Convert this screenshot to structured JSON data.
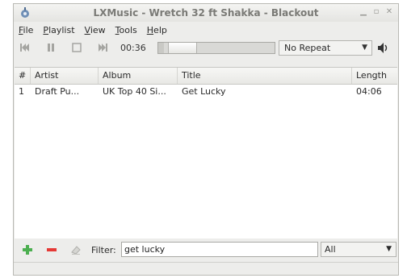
{
  "window": {
    "title": "LXMusic - Wretch 32 ft Shakka - Blackout",
    "controls": [
      "minimize-icon",
      "maximize-icon",
      "close-icon"
    ]
  },
  "menubar": {
    "items": [
      {
        "first": "F",
        "rest": "ile"
      },
      {
        "first": "P",
        "rest": "laylist"
      },
      {
        "first": "V",
        "rest": "iew"
      },
      {
        "first": "T",
        "rest": "ools"
      },
      {
        "first": "H",
        "rest": "elp"
      }
    ]
  },
  "toolbar": {
    "icons": [
      "previous-icon",
      "pause-icon",
      "stop-icon",
      "next-icon"
    ],
    "time": "00:36",
    "progress": 0.05,
    "repeat_value": "No Repeat",
    "volume_icon": "volume-icon"
  },
  "table": {
    "headers": [
      "#",
      "Artist",
      "Album",
      "Title",
      "Length"
    ],
    "rows": [
      [
        "1",
        "Draft Pu...",
        "UK Top 40 Si...",
        "Get Lucky",
        "04:06"
      ]
    ]
  },
  "bottombar": {
    "icons": [
      "add-icon",
      "remove-icon",
      "clear-icon"
    ],
    "filter_label": "Filter:",
    "filter_value": "get lucky",
    "filter_field": "All"
  },
  "colors": {
    "add": "#4caf50",
    "remove": "#e53935"
  }
}
